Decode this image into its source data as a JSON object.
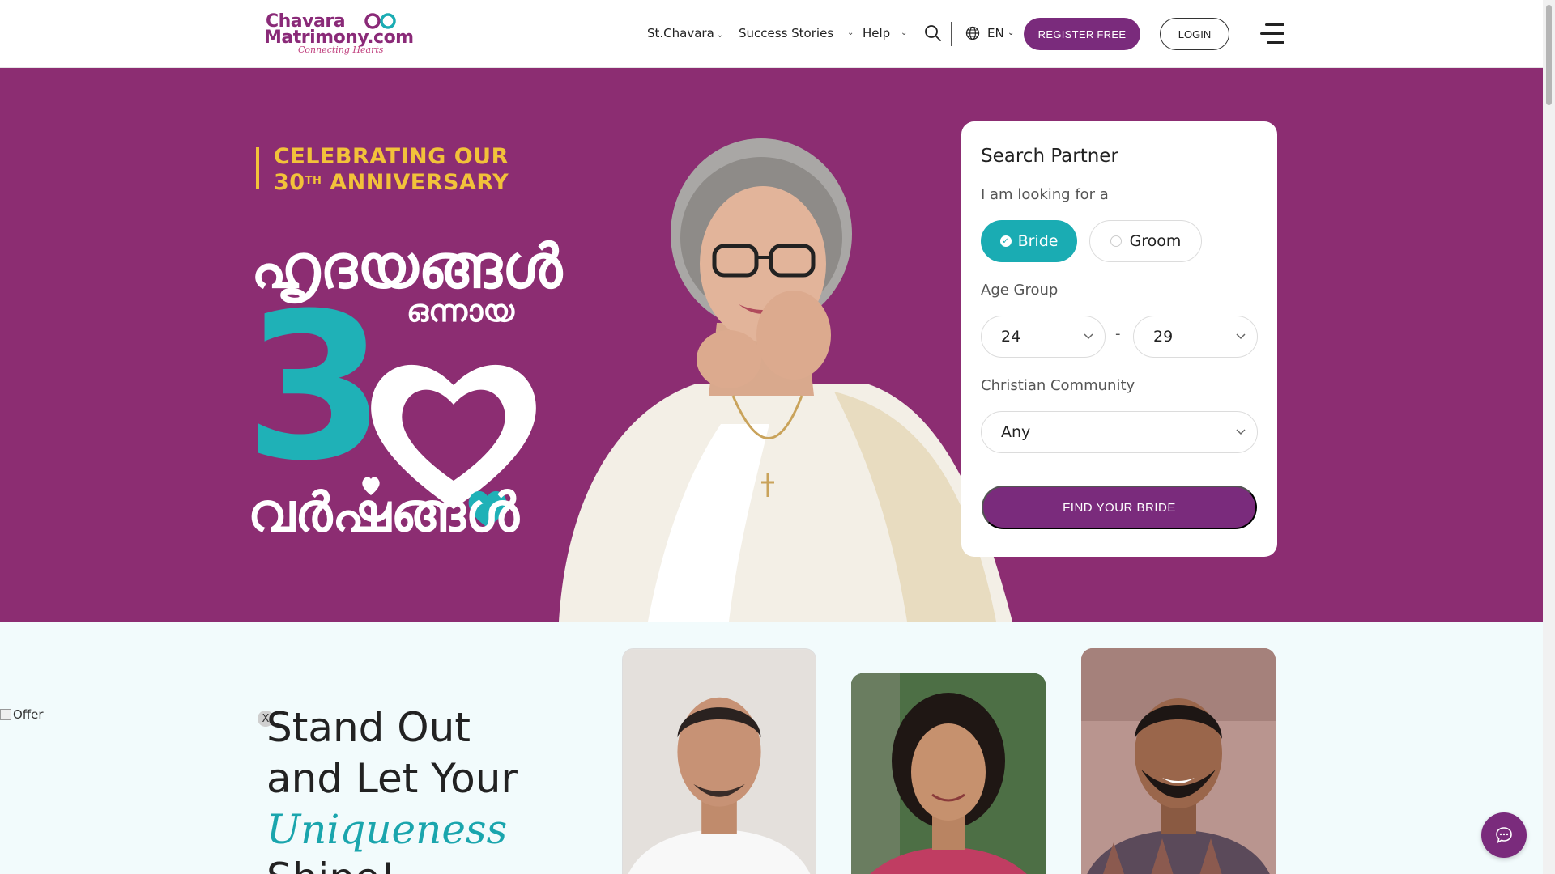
{
  "logo": {
    "line1": "Chavara",
    "line2": "Matrimony.com",
    "tagline": "Connecting Hearts"
  },
  "nav": {
    "items": [
      {
        "label": "St.Chavara"
      },
      {
        "label": "Success Stories"
      },
      {
        "label": "Help"
      }
    ],
    "language": "EN",
    "register_label": "REGISTER FREE",
    "login_label": "LOGIN"
  },
  "hero": {
    "anniversary_line1": "CELEBRATING OUR",
    "anniversary_num": "30",
    "anniversary_sup": "TH",
    "anniversary_word": "ANNIVERSARY",
    "mal_top": "ഹൃദയങ്ങൾ",
    "mal_mid": "ഒന്നായ",
    "big_number": "3",
    "mal_bottom": "വർഷങ്ങൾ"
  },
  "search": {
    "title": "Search Partner",
    "looking_for_label": "I am looking for a",
    "bride_label": "Bride",
    "groom_label": "Groom",
    "selected": "Bride",
    "age_group_label": "Age Group",
    "age_from": "24",
    "age_to": "29",
    "age_separator": "-",
    "community_label": "Christian Community",
    "community_value": "Any",
    "submit_label": "FIND YOUR BRIDE"
  },
  "lower": {
    "offer_alt": "Offer",
    "close_label": "X",
    "headline_line1": "Stand Out",
    "headline_line2": "and Let Your",
    "headline_line3": "Uniqueness",
    "headline_line4": "Shine!"
  },
  "colors": {
    "brand_purple": "#7a2b7c",
    "hero_bg": "#8c2d72",
    "teal": "#1aacb3",
    "gold": "#f2c23a"
  },
  "icons": {
    "search": "search-icon",
    "globe": "globe-icon",
    "menu": "hamburger-icon",
    "chat": "chat-icon"
  }
}
